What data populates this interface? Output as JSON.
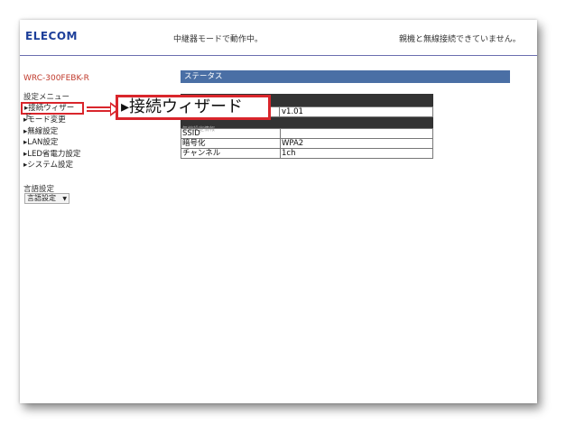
{
  "header": {
    "logo": "ELECOM",
    "mode_status": "中継器モードで動作中。",
    "connection_status": "親機と無線接続できていません。"
  },
  "model": "WRC-300FEBK-R",
  "status_header": "ステータス",
  "menu": {
    "title": "設定メニュー",
    "items": [
      {
        "label": "▸接続ウィザード",
        "highlighted": true
      },
      {
        "label": "▸モード変更"
      },
      {
        "label": "▸無線設定"
      },
      {
        "label": "▸LAN設定"
      },
      {
        "label": "▸LED省電力設定"
      },
      {
        "label": "▸システム設定"
      }
    ]
  },
  "language": {
    "title": "言語設定",
    "selected": "言語設定",
    "caret": "▼"
  },
  "firmware": {
    "value": "v1.01"
  },
  "wireless_section": "無線設定情報",
  "info_rows": [
    {
      "key": "SSID",
      "value": ""
    },
    {
      "key": "暗号化",
      "value": "WPA2"
    },
    {
      "key": "チャンネル",
      "value": "1ch"
    }
  ],
  "callout": {
    "label": "▸接続ウィザード"
  },
  "colors": {
    "accent_red": "#d9262c",
    "header_blue": "#4a6fa5",
    "logo_blue": "#1d3f9a",
    "model_red": "#c0392b"
  }
}
